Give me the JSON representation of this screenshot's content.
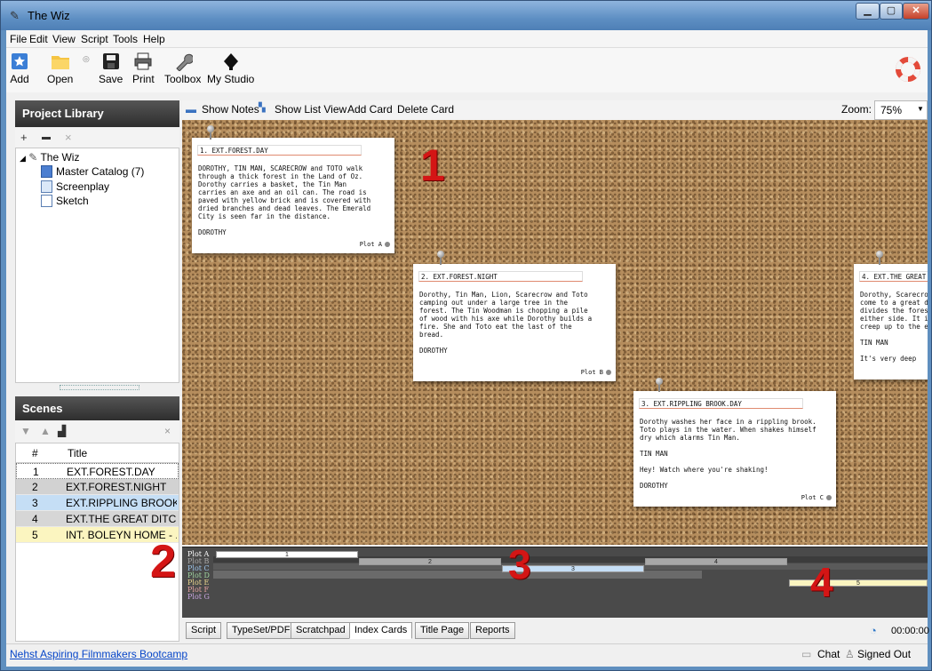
{
  "window": {
    "title": "The Wiz"
  },
  "menu": [
    "File",
    "Edit",
    "View",
    "Script",
    "Tools",
    "Help"
  ],
  "toolbar": [
    {
      "label": "Add",
      "icon": "add-icon"
    },
    {
      "label": "Open",
      "icon": "folder-icon"
    },
    {
      "label": "Save",
      "icon": "save-icon"
    },
    {
      "label": "Print",
      "icon": "printer-icon"
    },
    {
      "label": "Toolbox",
      "icon": "wrench-icon"
    },
    {
      "label": "My Studio",
      "icon": "studio-icon"
    }
  ],
  "project_library": {
    "title": "Project Library",
    "root": "The Wiz",
    "items": [
      "Master Catalog (7)",
      "Screenplay",
      "Sketch"
    ]
  },
  "scenes": {
    "title": "Scenes",
    "headers": [
      "#",
      "Title"
    ],
    "rows": [
      {
        "num": "1",
        "title": "EXT.FOREST.DAY",
        "color": "#ffffff"
      },
      {
        "num": "2",
        "title": "EXT.FOREST.NIGHT",
        "color": "#d2d2d2"
      },
      {
        "num": "3",
        "title": "EXT.RIPPLING BROOK....",
        "color": "#c5def5"
      },
      {
        "num": "4",
        "title": "EXT.THE GREAT DITC...",
        "color": "#d6d6d6"
      },
      {
        "num": "5",
        "title": "INT. BOLEYN HOME - ...",
        "color": "#fbf5c0"
      }
    ]
  },
  "corkboard_bar": {
    "show_notes": "Show Notes",
    "show_list": "Show List View",
    "add_card": "Add Card",
    "delete_card": "Delete Card",
    "zoom_label": "Zoom:",
    "zoom_value": "75%"
  },
  "cards": [
    {
      "heading": "1. EXT.FOREST.DAY",
      "body": "DOROTHY, TIN MAN, SCARECROW and TOTO walk\nthrough a thick forest in the Land of Oz.\nDorothy carries a basket, the Tin Man\ncarries an axe and an oil can. The road is\npaved with yellow brick and is covered with\ndried branches and dead leaves. The Emerald\nCity is seen far in the distance.\n\nDOROTHY",
      "plot": "Plot A"
    },
    {
      "heading": "2. EXT.FOREST.NIGHT",
      "body": "Dorothy, Tin Man, Lion, Scarecrow and Toto\ncamping out under a large tree in the\nforest. The Tin Woodman is chopping a pile\nof wood with his axe while Dorothy builds a\nfire. She and Toto eat the last of the\nbread.\n\nDOROTHY",
      "plot": "Plot B"
    },
    {
      "heading": "3. EXT.RIPPLING BROOK.DAY",
      "body": "Dorothy washes her face in a rippling brook.\nToto plays in the water. When shakes himself\ndry which alarms Tin Man.\n\nTIN MAN\n\nHey! Watch where you're shaking!\n\nDOROTHY",
      "plot": "Plot C"
    },
    {
      "heading": "4. EXT.THE GREAT DI",
      "body": "Dorothy, Scarecrow\ncome to a great di\ndivides the forest\neither side. It is\ncreep up to the ed\n\nTIN MAN\n\nIt's very deep",
      "plot": ""
    }
  ],
  "annotations": [
    "1",
    "2",
    "3",
    "4"
  ],
  "timeline": {
    "plots": [
      "Plot A",
      "Plot B",
      "Plot C",
      "Plot D",
      "Plot E",
      "Plot F",
      "Plot G"
    ],
    "bars": [
      "1",
      "2",
      "3",
      "4",
      "5"
    ]
  },
  "tabs": [
    "Script",
    "TypeSet/PDF",
    "Scratchpad",
    "Index Cards",
    "Title Page",
    "Reports"
  ],
  "active_tab": "Index Cards",
  "time_display": "00:00:00",
  "status": {
    "link": "Nehst Aspiring Filmmakers Bootcamp",
    "chat": "Chat",
    "signed": "Signed Out"
  }
}
